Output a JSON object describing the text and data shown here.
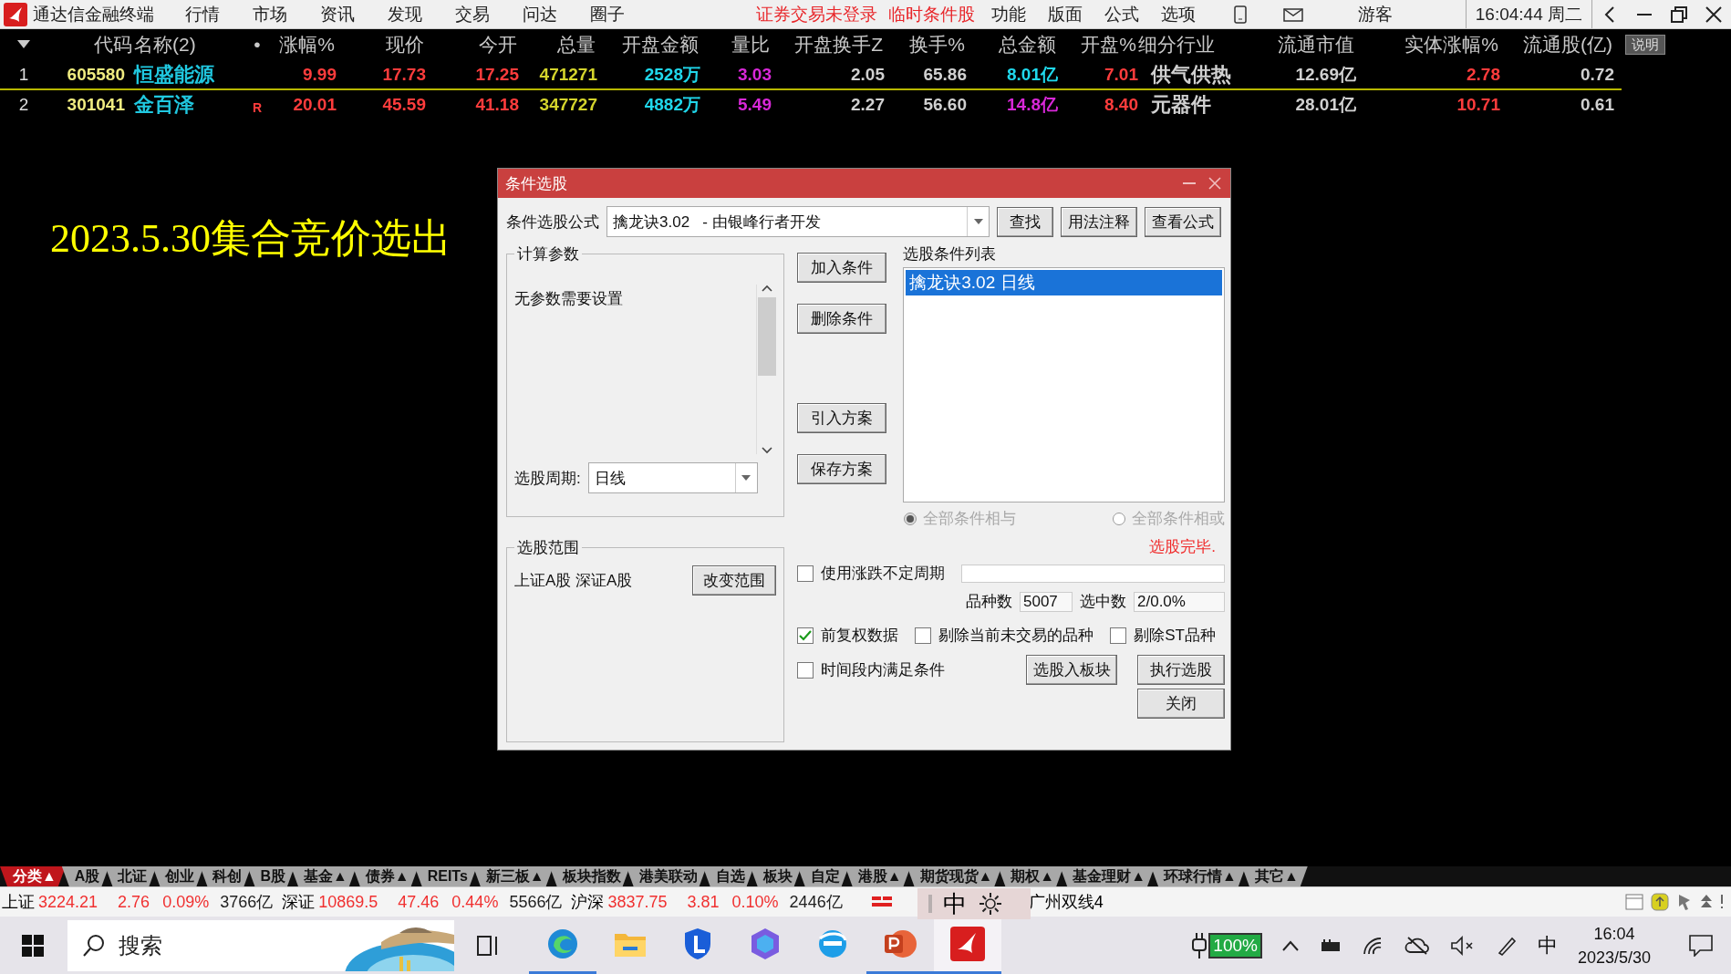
{
  "app": {
    "title": "通达信金融终端",
    "menu": [
      "行情",
      "市场",
      "资讯",
      "发现",
      "交易",
      "问达",
      "圈子"
    ],
    "alerts": [
      "证券交易未登录",
      "临时条件股"
    ],
    "menu2": [
      "功能",
      "版面",
      "公式",
      "选项"
    ],
    "user": "游客",
    "clock": "16:04:44 周二"
  },
  "table": {
    "columns": [
      "代码",
      "名称(2)",
      "•",
      "涨幅%",
      "现价",
      "今开",
      "总量",
      "开盘金额",
      "量比",
      "开盘换手Z",
      "换手%",
      "总金额",
      "开盘%",
      "细分行业",
      "流通市值",
      "实体涨幅%",
      "流通股(亿)"
    ],
    "note_button": "说明",
    "rows": [
      {
        "index": "1",
        "selected": true,
        "cells": [
          {
            "text": "605580",
            "color": "#f0ec80"
          },
          {
            "text": "恒盛能源",
            "color": "#20c8e0"
          },
          {
            "text": ""
          },
          {
            "text": "9.99",
            "color": "#ff3c3c"
          },
          {
            "text": "17.73",
            "color": "#ff3c3c"
          },
          {
            "text": "17.25",
            "color": "#ff3c3c"
          },
          {
            "text": "471271",
            "color": "#d4d42c"
          },
          {
            "text": "2528万",
            "color": "#20d8ec"
          },
          {
            "text": "3.03",
            "color": "#d828d8"
          },
          {
            "text": "2.05",
            "color": "#d0d0d0"
          },
          {
            "text": "65.86",
            "color": "#d0d0d0"
          },
          {
            "text": "8.01亿",
            "color": "#20d8ec"
          },
          {
            "text": "7.01",
            "color": "#ff3c3c"
          },
          {
            "text": "供气供热",
            "color": "#d0d0d0"
          },
          {
            "text": "12.69亿",
            "color": "#d0d0d0"
          },
          {
            "text": "2.78",
            "color": "#ff3c3c"
          },
          {
            "text": "0.72",
            "color": "#d0d0d0"
          }
        ]
      },
      {
        "index": "2",
        "selected": false,
        "cells": [
          {
            "text": "301041",
            "color": "#f0ec80"
          },
          {
            "text": "金百泽",
            "color": "#20c8e0"
          },
          {
            "text": "R",
            "color": "#ff3c3c"
          },
          {
            "text": "20.01",
            "color": "#ff3c3c"
          },
          {
            "text": "45.59",
            "color": "#ff3c3c"
          },
          {
            "text": "41.18",
            "color": "#ff3c3c"
          },
          {
            "text": "347727",
            "color": "#d4d42c"
          },
          {
            "text": "4882万",
            "color": "#20d8ec"
          },
          {
            "text": "5.49",
            "color": "#d828d8"
          },
          {
            "text": "2.27",
            "color": "#d0d0d0"
          },
          {
            "text": "56.60",
            "color": "#d0d0d0"
          },
          {
            "text": "14.8亿",
            "color": "#d828d8"
          },
          {
            "text": "8.40",
            "color": "#ff3c3c"
          },
          {
            "text": "元器件",
            "color": "#d0d0d0"
          },
          {
            "text": "28.01亿",
            "color": "#d0d0d0"
          },
          {
            "text": "10.71",
            "color": "#ff3c3c"
          },
          {
            "text": "0.61",
            "color": "#d0d0d0"
          }
        ]
      }
    ]
  },
  "caption": "2023.5.30集合竞价选出",
  "dialog": {
    "title": "条件选股",
    "formula_label": "条件选股公式",
    "formula": "擒龙诀3.02   - 由银峰行者开发",
    "top_buttons": [
      "查找",
      "用法注释",
      "查看公式"
    ],
    "params": {
      "legend": "计算参数",
      "message": "无参数需要设置",
      "period_label": "选股周期:",
      "period": "日线"
    },
    "side_buttons": [
      "加入条件",
      "删除条件",
      "引入方案",
      "保存方案"
    ],
    "list": {
      "label": "选股条件列表",
      "items": [
        {
          "text": "擒龙诀3.02  日线",
          "selected": true
        }
      ]
    },
    "logic": [
      {
        "label": "全部条件相与",
        "selected": true,
        "disabled": true
      },
      {
        "label": "全部条件相或",
        "selected": false,
        "disabled": true
      }
    ],
    "status": "选股完毕.",
    "range": {
      "legend": "选股范围",
      "value": "上证A股 深证A股",
      "button": "改变范围"
    },
    "uncertain_period": {
      "label": "使用涨跌不定周期",
      "checked": false
    },
    "counts": [
      {
        "label": "品种数",
        "value": "5007"
      },
      {
        "label": "选中数",
        "value": "2/0.0%"
      }
    ],
    "options": [
      {
        "label": "前复权数据",
        "checked": true
      },
      {
        "label": "剔除当前未交易的品种",
        "checked": false
      },
      {
        "label": "剔除ST品种",
        "checked": false
      }
    ],
    "period_check": {
      "label": "时间段内满足条件",
      "checked": false
    },
    "action_buttons": [
      "选股入板块",
      "执行选股",
      "关闭"
    ]
  },
  "tabs": [
    {
      "label": "分类▲",
      "selected": true
    },
    {
      "label": "A股",
      "selected": false
    },
    {
      "label": "北证",
      "selected": false
    },
    {
      "label": "创业",
      "selected": false
    },
    {
      "label": "科创",
      "selected": false
    },
    {
      "label": "B股",
      "selected": false
    },
    {
      "label": "基金▲",
      "selected": false
    },
    {
      "label": "债券▲",
      "selected": false
    },
    {
      "label": "REITs",
      "selected": false
    },
    {
      "label": "新三板▲",
      "selected": false
    },
    {
      "label": "板块指数",
      "selected": false
    },
    {
      "label": "港美联动",
      "selected": false
    },
    {
      "label": "自选",
      "selected": false
    },
    {
      "label": "板块",
      "selected": false
    },
    {
      "label": "自定",
      "selected": false
    },
    {
      "label": "港股▲",
      "selected": false
    },
    {
      "label": "期货现货▲",
      "selected": false
    },
    {
      "label": "期权▲",
      "selected": false
    },
    {
      "label": "基金理财▲",
      "selected": false
    },
    {
      "label": "环球行情▲",
      "selected": false
    },
    {
      "label": "其它▲",
      "selected": false
    }
  ],
  "indices": [
    {
      "name": "上证",
      "price": "3224.21",
      "change": "2.76",
      "pct": "0.09%",
      "amount": "3766亿"
    },
    {
      "name": "深证",
      "price": "10869.5",
      "change": "47.46",
      "pct": "0.44%",
      "amount": "5566亿"
    },
    {
      "name": "沪深",
      "price": "3837.75",
      "change": "3.81",
      "pct": "0.10%",
      "amount": "2446亿"
    }
  ],
  "server": "广州双线4",
  "ime": {
    "mode": "中"
  },
  "taskbar": {
    "search": "搜索",
    "apps": [
      {
        "kind": "edge",
        "running": true,
        "selected": false
      },
      {
        "kind": "folder",
        "running": false,
        "selected": false
      },
      {
        "kind": "lapp",
        "running": false,
        "selected": false
      },
      {
        "kind": "copilot",
        "running": false,
        "selected": false
      },
      {
        "kind": "ie",
        "running": false,
        "selected": false
      },
      {
        "kind": "ppt",
        "running": true,
        "selected": false
      },
      {
        "kind": "tdx",
        "running": true,
        "selected": true
      }
    ],
    "battery": "100%",
    "ime": "中",
    "time": "16:04",
    "date": "2023/5/30"
  }
}
